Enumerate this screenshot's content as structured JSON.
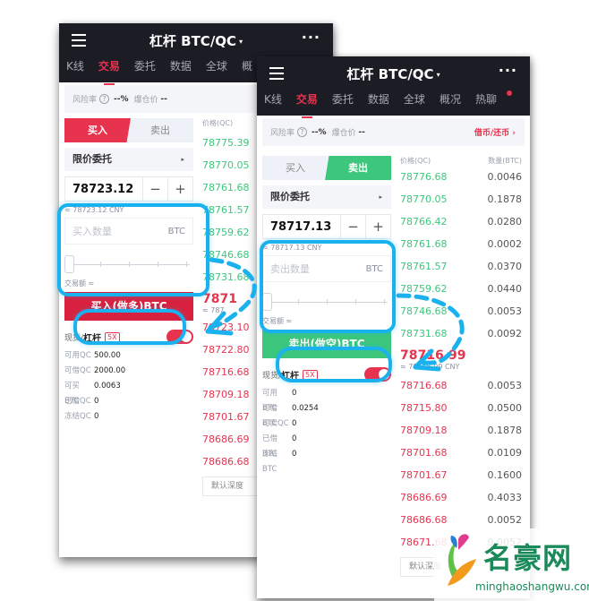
{
  "colors": {
    "header_bg": "#1b1c24",
    "accent_red": "#e8334f",
    "buy_button": "#d8213f",
    "accent_green": "#3cc77c",
    "highlight_blue": "#19b1ee"
  },
  "screen_buy": {
    "header": {
      "title": "杠杆 BTC/QC",
      "caret": "▾",
      "more": "···"
    },
    "tabs": [
      "K线",
      "交易",
      "委托",
      "数据",
      "全球",
      "概"
    ],
    "active_tab": "交易",
    "risk": {
      "label": "风险率",
      "help": "?",
      "value": "--%",
      "liq_label": "爆仓价",
      "liq_value": "--"
    },
    "side_buy": "买入",
    "side_sell": "卖出",
    "order_type": "限价委托",
    "order_type_arrow": "▸",
    "price_value": "78723.12",
    "minus": "−",
    "plus": "+",
    "price_cny": "≈ 78723.12 CNY",
    "qty_placeholder": "买入数量",
    "qty_unit": "BTC",
    "amount_label": "交易额 ≈",
    "action_label": "买入(做多)BTC",
    "mode_label_prefix": "现货/",
    "mode_label_bold": "杠杆",
    "leverage": "5X",
    "account": [
      {
        "k": "可用QC",
        "v": "500.00"
      },
      {
        "k": "可借QC",
        "v": "2000.00"
      },
      {
        "k": "可买BTC",
        "v": "0.0063"
      },
      {
        "k": "已借QC",
        "v": "0"
      },
      {
        "k": "冻结QC",
        "v": "0"
      }
    ],
    "orderbook": {
      "price_header": "价格(QC)",
      "asks": [
        "78775.39",
        "78770.05",
        "78761.68",
        "78761.57",
        "78759.62",
        "78746.68",
        "78731.68"
      ],
      "last_price": "7871",
      "last_cny": "≈ 787",
      "bids": [
        "78723.10",
        "78722.80",
        "78716.68",
        "78709.18",
        "78701.67",
        "78686.69",
        "78686.68"
      ],
      "depth_label": "默认深度"
    }
  },
  "screen_sell": {
    "header": {
      "title": "杠杆 BTC/QC",
      "caret": "▾",
      "more": "···"
    },
    "tabs": [
      "K线",
      "交易",
      "委托",
      "数据",
      "全球",
      "概况",
      "热聊"
    ],
    "active_tab": "交易",
    "risk": {
      "label": "风险率",
      "help": "?",
      "value": "--%",
      "liq_label": "爆仓价",
      "liq_value": "--",
      "borrow_link": "借币/还币 ›"
    },
    "side_buy": "买入",
    "side_sell": "卖出",
    "order_type": "限价委托",
    "order_type_arrow": "▸",
    "price_value": "78717.13",
    "minus": "−",
    "plus": "+",
    "price_cny": "≈ 78717.13 CNY",
    "qty_placeholder": "卖出数量",
    "qty_unit": "BTC",
    "amount_label": "交易额 ≈",
    "action_label": "卖出(做空)BTC",
    "mode_label_prefix": "现货/",
    "mode_label_bold": "杠杆",
    "leverage": "5X",
    "account": [
      {
        "k": "可用BTC",
        "v": "0"
      },
      {
        "k": "可借BTC",
        "v": "0.0254"
      },
      {
        "k": "可卖QC",
        "v": "0"
      },
      {
        "k": "已借BTC",
        "v": "0"
      },
      {
        "k": "冻结BTC",
        "v": "0"
      }
    ],
    "orderbook": {
      "price_header": "价格(QC)",
      "qty_header": "数量(BTC)",
      "asks": [
        {
          "p": "78776.68",
          "q": "0.0046"
        },
        {
          "p": "78770.05",
          "q": "0.1878"
        },
        {
          "p": "78766.42",
          "q": "0.0280"
        },
        {
          "p": "78761.68",
          "q": "0.0002"
        },
        {
          "p": "78761.57",
          "q": "0.0370"
        },
        {
          "p": "78759.62",
          "q": "0.0440"
        },
        {
          "p": "78746.68",
          "q": "0.0053"
        },
        {
          "p": "78731.68",
          "q": "0.0092"
        }
      ],
      "last_price": "78716.99",
      "last_cny": "≈ 78716.99 CNY",
      "bids": [
        {
          "p": "78716.68",
          "q": "0.0053"
        },
        {
          "p": "78715.80",
          "q": "0.0500"
        },
        {
          "p": "78709.18",
          "q": "0.1878"
        },
        {
          "p": "78701.68",
          "q": "0.0109"
        },
        {
          "p": "78701.67",
          "q": "0.1600"
        },
        {
          "p": "78686.69",
          "q": "0.4033"
        },
        {
          "p": "78686.68",
          "q": "0.0052"
        },
        {
          "p": "78671.68",
          "q": "0.0052"
        }
      ],
      "depth_label": "默认深度"
    }
  },
  "watermark": {
    "name": "名豪网",
    "url": "minghaoshangwu.com"
  }
}
